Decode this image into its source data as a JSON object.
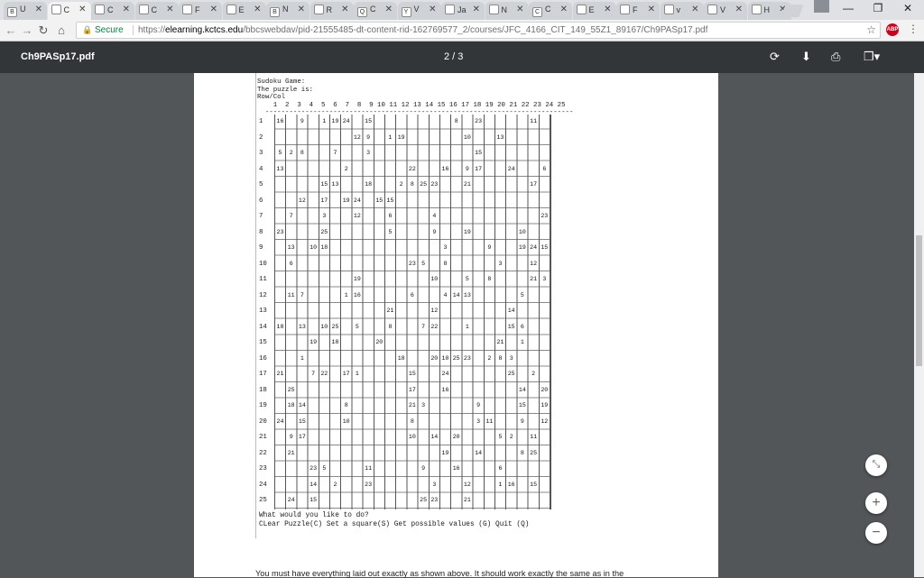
{
  "tabs": [
    {
      "icon": "Bb",
      "label": "U"
    },
    {
      "icon": "doc",
      "label": "C"
    },
    {
      "icon": "doc",
      "label": "C"
    },
    {
      "icon": "doc",
      "label": "C"
    },
    {
      "icon": "doc",
      "label": "F"
    },
    {
      "icon": "img",
      "label": "E"
    },
    {
      "icon": "Bb",
      "label": "N"
    },
    {
      "icon": "doc",
      "label": "R"
    },
    {
      "icon": "Q",
      "label": "C"
    },
    {
      "icon": "Y",
      "label": "V"
    },
    {
      "icon": "img",
      "label": "Ja"
    },
    {
      "icon": "doc",
      "label": "N"
    },
    {
      "icon": "C",
      "label": "C"
    },
    {
      "icon": "img",
      "label": "E"
    },
    {
      "icon": "print",
      "label": "F"
    },
    {
      "icon": "img",
      "label": "v"
    },
    {
      "icon": "img",
      "label": "V"
    },
    {
      "icon": "img",
      "label": "H"
    }
  ],
  "active_tab_index": 1,
  "address": {
    "secure_label": "Secure",
    "scheme": "https://",
    "host": "elearning.kctcs.edu",
    "path": "/bbcswebdav/pid-21555485-dt-content-rid-162769577_2/courses/JFC_4166_CIT_149_55Z1_89167/Ch9PASp17.pdf"
  },
  "extension_badge": "ABP",
  "pdf": {
    "filename": "Ch9PASp17.pdf",
    "page_indicator": "2 / 3"
  },
  "console": {
    "header": "Sudoku Game:\nThe puzzle is:\nRow/Col\n    1  2  3  4  5  6  7  8  9 10 11 12 13 14 15 16 17 18 19 20 21 22 23 24 25\n  -----------------------------------------------------------------------------",
    "row_numbers": [
      "1",
      "2",
      "3",
      "4",
      "5",
      "6",
      "7",
      "8",
      "9",
      "10",
      "11",
      "12",
      "13",
      "14",
      "15",
      "16",
      "17",
      "18",
      "19",
      "20",
      "21",
      "22",
      "23",
      "24",
      "25"
    ],
    "rows": [
      [
        "16",
        "",
        "9",
        "",
        "1",
        "19",
        "24",
        "",
        "15",
        "",
        "",
        "",
        "",
        "",
        "",
        "",
        "8",
        "",
        "23",
        "",
        "",
        "",
        "",
        "11",
        ""
      ],
      [
        "",
        "",
        "",
        "",
        "",
        "",
        "",
        "12",
        "9",
        "",
        "1",
        "19",
        "",
        "",
        "",
        "",
        "",
        "10",
        "",
        "",
        "13",
        "",
        "",
        "",
        ""
      ],
      [
        "5",
        "2",
        "8",
        "",
        "",
        "7",
        "",
        "",
        "3",
        "",
        "",
        "",
        "",
        "",
        "",
        "",
        "",
        "",
        "15",
        "",
        "",
        "",
        "",
        "",
        ""
      ],
      [
        "13",
        "",
        "",
        "",
        "",
        "",
        "2",
        "",
        "",
        "",
        "",
        "",
        "22",
        "",
        "",
        "16",
        "",
        "9",
        "17",
        "",
        "",
        "24",
        "",
        "",
        "6"
      ],
      [
        "",
        "",
        "",
        "",
        "15",
        "13",
        "",
        "",
        "18",
        "",
        "",
        "2",
        "8",
        "25",
        "23",
        "",
        "",
        "21",
        "",
        "",
        "",
        "",
        "",
        "17",
        ""
      ],
      [
        "",
        "",
        "12",
        "",
        "17",
        "",
        "19",
        "24",
        "",
        "15",
        "15",
        "",
        "",
        "",
        "",
        "",
        "",
        "",
        "",
        "",
        "",
        "",
        "",
        "",
        ""
      ],
      [
        "",
        "7",
        "",
        "",
        "3",
        "",
        "",
        "12",
        "",
        "",
        "6",
        "",
        "",
        "",
        "4",
        "",
        "",
        "",
        "",
        "",
        "",
        "",
        "",
        "",
        "23"
      ],
      [
        "23",
        "",
        "",
        "",
        "25",
        "",
        "",
        "",
        "",
        "",
        "5",
        "",
        "",
        "",
        "9",
        "",
        "",
        "19",
        "",
        "",
        "",
        "",
        "10",
        "",
        ""
      ],
      [
        "",
        "13",
        "",
        "10",
        "18",
        "",
        "",
        "",
        "",
        "",
        "",
        "",
        "",
        "",
        "",
        "3",
        "",
        "",
        "",
        "9",
        "",
        "",
        "19",
        "24",
        "15"
      ],
      [
        "",
        "6",
        "",
        "",
        "",
        "",
        "",
        "",
        "",
        "",
        "",
        "",
        "23",
        "5",
        "",
        "8",
        "",
        "",
        "",
        "",
        "3",
        "",
        "",
        "12",
        ""
      ],
      [
        "",
        "",
        "",
        "",
        "",
        "",
        "",
        "19",
        "",
        "",
        "",
        "",
        "",
        "",
        "10",
        "",
        "",
        "5",
        "",
        "8",
        "",
        "",
        "",
        "21",
        "3"
      ],
      [
        "",
        "11",
        "7",
        "",
        "",
        "",
        "1",
        "16",
        "",
        "",
        "",
        "",
        "6",
        "",
        "",
        "4",
        "14",
        "13",
        "",
        "",
        "",
        "",
        "5",
        "",
        ""
      ],
      [
        "",
        "",
        "",
        "",
        "",
        "",
        "",
        "",
        "",
        "",
        "21",
        "",
        "",
        "",
        "12",
        "",
        "",
        "",
        "",
        "",
        "",
        "14",
        "",
        "",
        ""
      ],
      [
        "18",
        "",
        "13",
        "",
        "10",
        "25",
        "",
        "5",
        "",
        "",
        "8",
        "",
        "",
        "7",
        "22",
        "",
        "",
        "1",
        "",
        "",
        "",
        "15",
        "6",
        "",
        ""
      ],
      [
        "",
        "",
        "",
        "19",
        "",
        "18",
        "",
        "",
        "",
        "20",
        "",
        "",
        "",
        "",
        "",
        "",
        "",
        "",
        "",
        "",
        "21",
        "",
        "1",
        "",
        ""
      ],
      [
        "",
        "",
        "1",
        "",
        "",
        "",
        "",
        "",
        "",
        "",
        "",
        "18",
        "",
        "",
        "20",
        "10",
        "25",
        "23",
        "",
        "2",
        "8",
        "3",
        "",
        "",
        ""
      ],
      [
        "21",
        "",
        "",
        "7",
        "22",
        "",
        "17",
        "1",
        "",
        "",
        "",
        "",
        "15",
        "",
        "",
        "24",
        "",
        "",
        "",
        "",
        "",
        "25",
        "",
        "2",
        ""
      ],
      [
        "",
        "25",
        "",
        "",
        "",
        "",
        "",
        "",
        "",
        "",
        "",
        "",
        "17",
        "",
        "",
        "16",
        "",
        "",
        "",
        "",
        "",
        "",
        "14",
        "",
        "20"
      ],
      [
        "",
        "18",
        "14",
        "",
        "",
        "",
        "8",
        "",
        "",
        "",
        "",
        "",
        "21",
        "3",
        "",
        "",
        "",
        "",
        "9",
        "",
        "",
        "",
        "15",
        "",
        "19"
      ],
      [
        "24",
        "",
        "15",
        "",
        "",
        "",
        "10",
        "",
        "",
        "",
        "",
        "",
        "8",
        "",
        "",
        "",
        "",
        "",
        "3",
        "11",
        "",
        "",
        "9",
        "",
        "12"
      ],
      [
        "",
        "9",
        "17",
        "",
        "",
        "",
        "",
        "",
        "",
        "",
        "",
        "",
        "10",
        "",
        "14",
        "",
        "20",
        "",
        "",
        "",
        "5",
        "2",
        "",
        "11",
        ""
      ],
      [
        "",
        "21",
        "",
        "",
        "",
        "",
        "",
        "",
        "",
        "",
        "",
        "",
        "",
        "",
        "",
        "19",
        "",
        "",
        "14",
        "",
        "",
        "",
        "8",
        "25",
        ""
      ],
      [
        "",
        "",
        "",
        "23",
        "5",
        "",
        "",
        "",
        "11",
        "",
        "",
        "",
        "",
        "9",
        "",
        "",
        "16",
        "",
        "",
        "",
        "6",
        "",
        "",
        "",
        ""
      ],
      [
        "",
        "",
        "",
        "14",
        "",
        "2",
        "",
        "",
        "23",
        "",
        "",
        "",
        "",
        "",
        "3",
        "",
        "",
        "12",
        "",
        "",
        "1",
        "16",
        "",
        "15",
        ""
      ],
      [
        "",
        "24",
        "",
        "15",
        "",
        "",
        "",
        "",
        "",
        "",
        "",
        "",
        "",
        "25",
        "23",
        "",
        "",
        "21",
        "",
        "",
        "",
        "",
        "",
        "",
        ""
      ]
    ],
    "prompt_line1": "What would you like to do?",
    "prompt_line2": "CLear Puzzle(C) Set a square(S) Get possible values (G) Quit (Q)"
  },
  "page_text": "You must have everything laid out exactly as shown above.  It should work exactly the same as in the",
  "colors": {
    "viewer_bg": "#525659",
    "toolbar": "#323639",
    "secure_green": "#0b8043"
  }
}
